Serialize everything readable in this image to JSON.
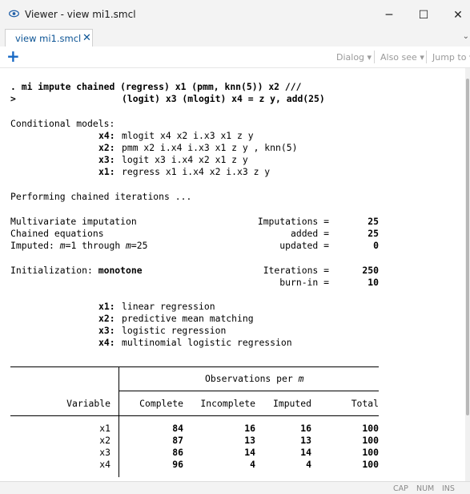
{
  "window": {
    "title": "Viewer - view mi1.smcl",
    "minimize": "─",
    "maximize": "☐",
    "close": "✕"
  },
  "tab": {
    "label": "view mi1.smcl",
    "close": "✕",
    "menu": "⌄"
  },
  "toolbar": {
    "add": "+",
    "dialog": "Dialog",
    "also_see": "Also see",
    "jump_to": "Jump to",
    "caret": "▾"
  },
  "output": {
    "cmd1_prompt": ". ",
    "cmd1": "mi impute chained (regress) x1 (pmm, knn(5)) x2 ///",
    "cmd2_prompt": ">",
    "cmd2": "(logit) x3 (mlogit) x4 = z y, add(25)",
    "cond_header": "Conditional models:",
    "cond": [
      {
        "var": "x4:",
        "model": "mlogit x4 x2 i.x3 x1 z y"
      },
      {
        "var": "x2:",
        "model": "pmm x2 i.x4 i.x3 x1 z y , knn(5)"
      },
      {
        "var": "x3:",
        "model": "logit x3 i.x4 x2 x1 z y"
      },
      {
        "var": "x1:",
        "model": "regress x1 i.x4 x2 i.x3 z y"
      }
    ],
    "performing": "Performing chained iterations ...",
    "mi_label": "Multivariate imputation",
    "ce_label": "Chained equations",
    "imp_prefix": "Imputed: ",
    "imp_m1": "m",
    "imp_mid": "=1 through ",
    "imp_m2": "m",
    "imp_end": "=25",
    "imputations_label": "Imputations =",
    "imputations_value": "25",
    "added_label": "added =",
    "added_value": "25",
    "updated_label": "updated =",
    "updated_value": "0",
    "init_label": "Initialization: ",
    "init_value": "monotone",
    "iterations_label": "Iterations =",
    "iterations_value": "250",
    "burnin_label": "burn-in =",
    "burnin_value": "10",
    "methods": [
      {
        "var": "x1:",
        "method": "linear regression"
      },
      {
        "var": "x2:",
        "method": "predictive mean matching"
      },
      {
        "var": "x3:",
        "method": "logistic regression"
      },
      {
        "var": "x4:",
        "method": "multinomial logistic regression"
      }
    ]
  },
  "table": {
    "group_header_prefix": "Observations per ",
    "group_header_m": "m",
    "columns": [
      "Variable",
      "Complete",
      "Incomplete",
      "Imputed",
      "Total"
    ],
    "rows": [
      [
        "x1",
        "84",
        "16",
        "16",
        "100"
      ],
      [
        "x2",
        "87",
        "13",
        "13",
        "100"
      ],
      [
        "x3",
        "86",
        "14",
        "14",
        "100"
      ],
      [
        "x4",
        "96",
        "4",
        "4",
        "100"
      ]
    ]
  },
  "status": {
    "cap": "CAP",
    "num": "NUM",
    "ins": "INS"
  }
}
